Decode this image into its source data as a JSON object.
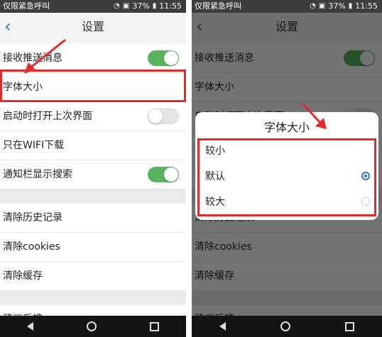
{
  "status": {
    "left_text": "仅限紧急呼叫",
    "battery": "37%",
    "time": "11:55"
  },
  "header": {
    "back_icon": "chevron-left-icon",
    "title": "设置"
  },
  "settings": {
    "items": [
      {
        "label": "接收推送消息",
        "toggle": "on"
      },
      {
        "label": "字体大小"
      },
      {
        "label": "启动时打开上次界面",
        "toggle": "off"
      },
      {
        "label": "只在WIFI下载"
      },
      {
        "label": "通知栏显示搜索",
        "toggle": "on"
      },
      {
        "label": "清除历史记录"
      },
      {
        "label": "清除cookies"
      },
      {
        "label": "清除缓存"
      },
      {
        "label": "建议反馈"
      }
    ]
  },
  "dialog": {
    "title": "字体大小",
    "options": [
      {
        "label": "较小",
        "selected": false
      },
      {
        "label": "默认",
        "selected": true
      },
      {
        "label": "较大",
        "selected": false
      }
    ]
  },
  "colors": {
    "accent": "#2f74c0",
    "toggle_on": "#58b35c",
    "highlight": "#e12a2a"
  }
}
